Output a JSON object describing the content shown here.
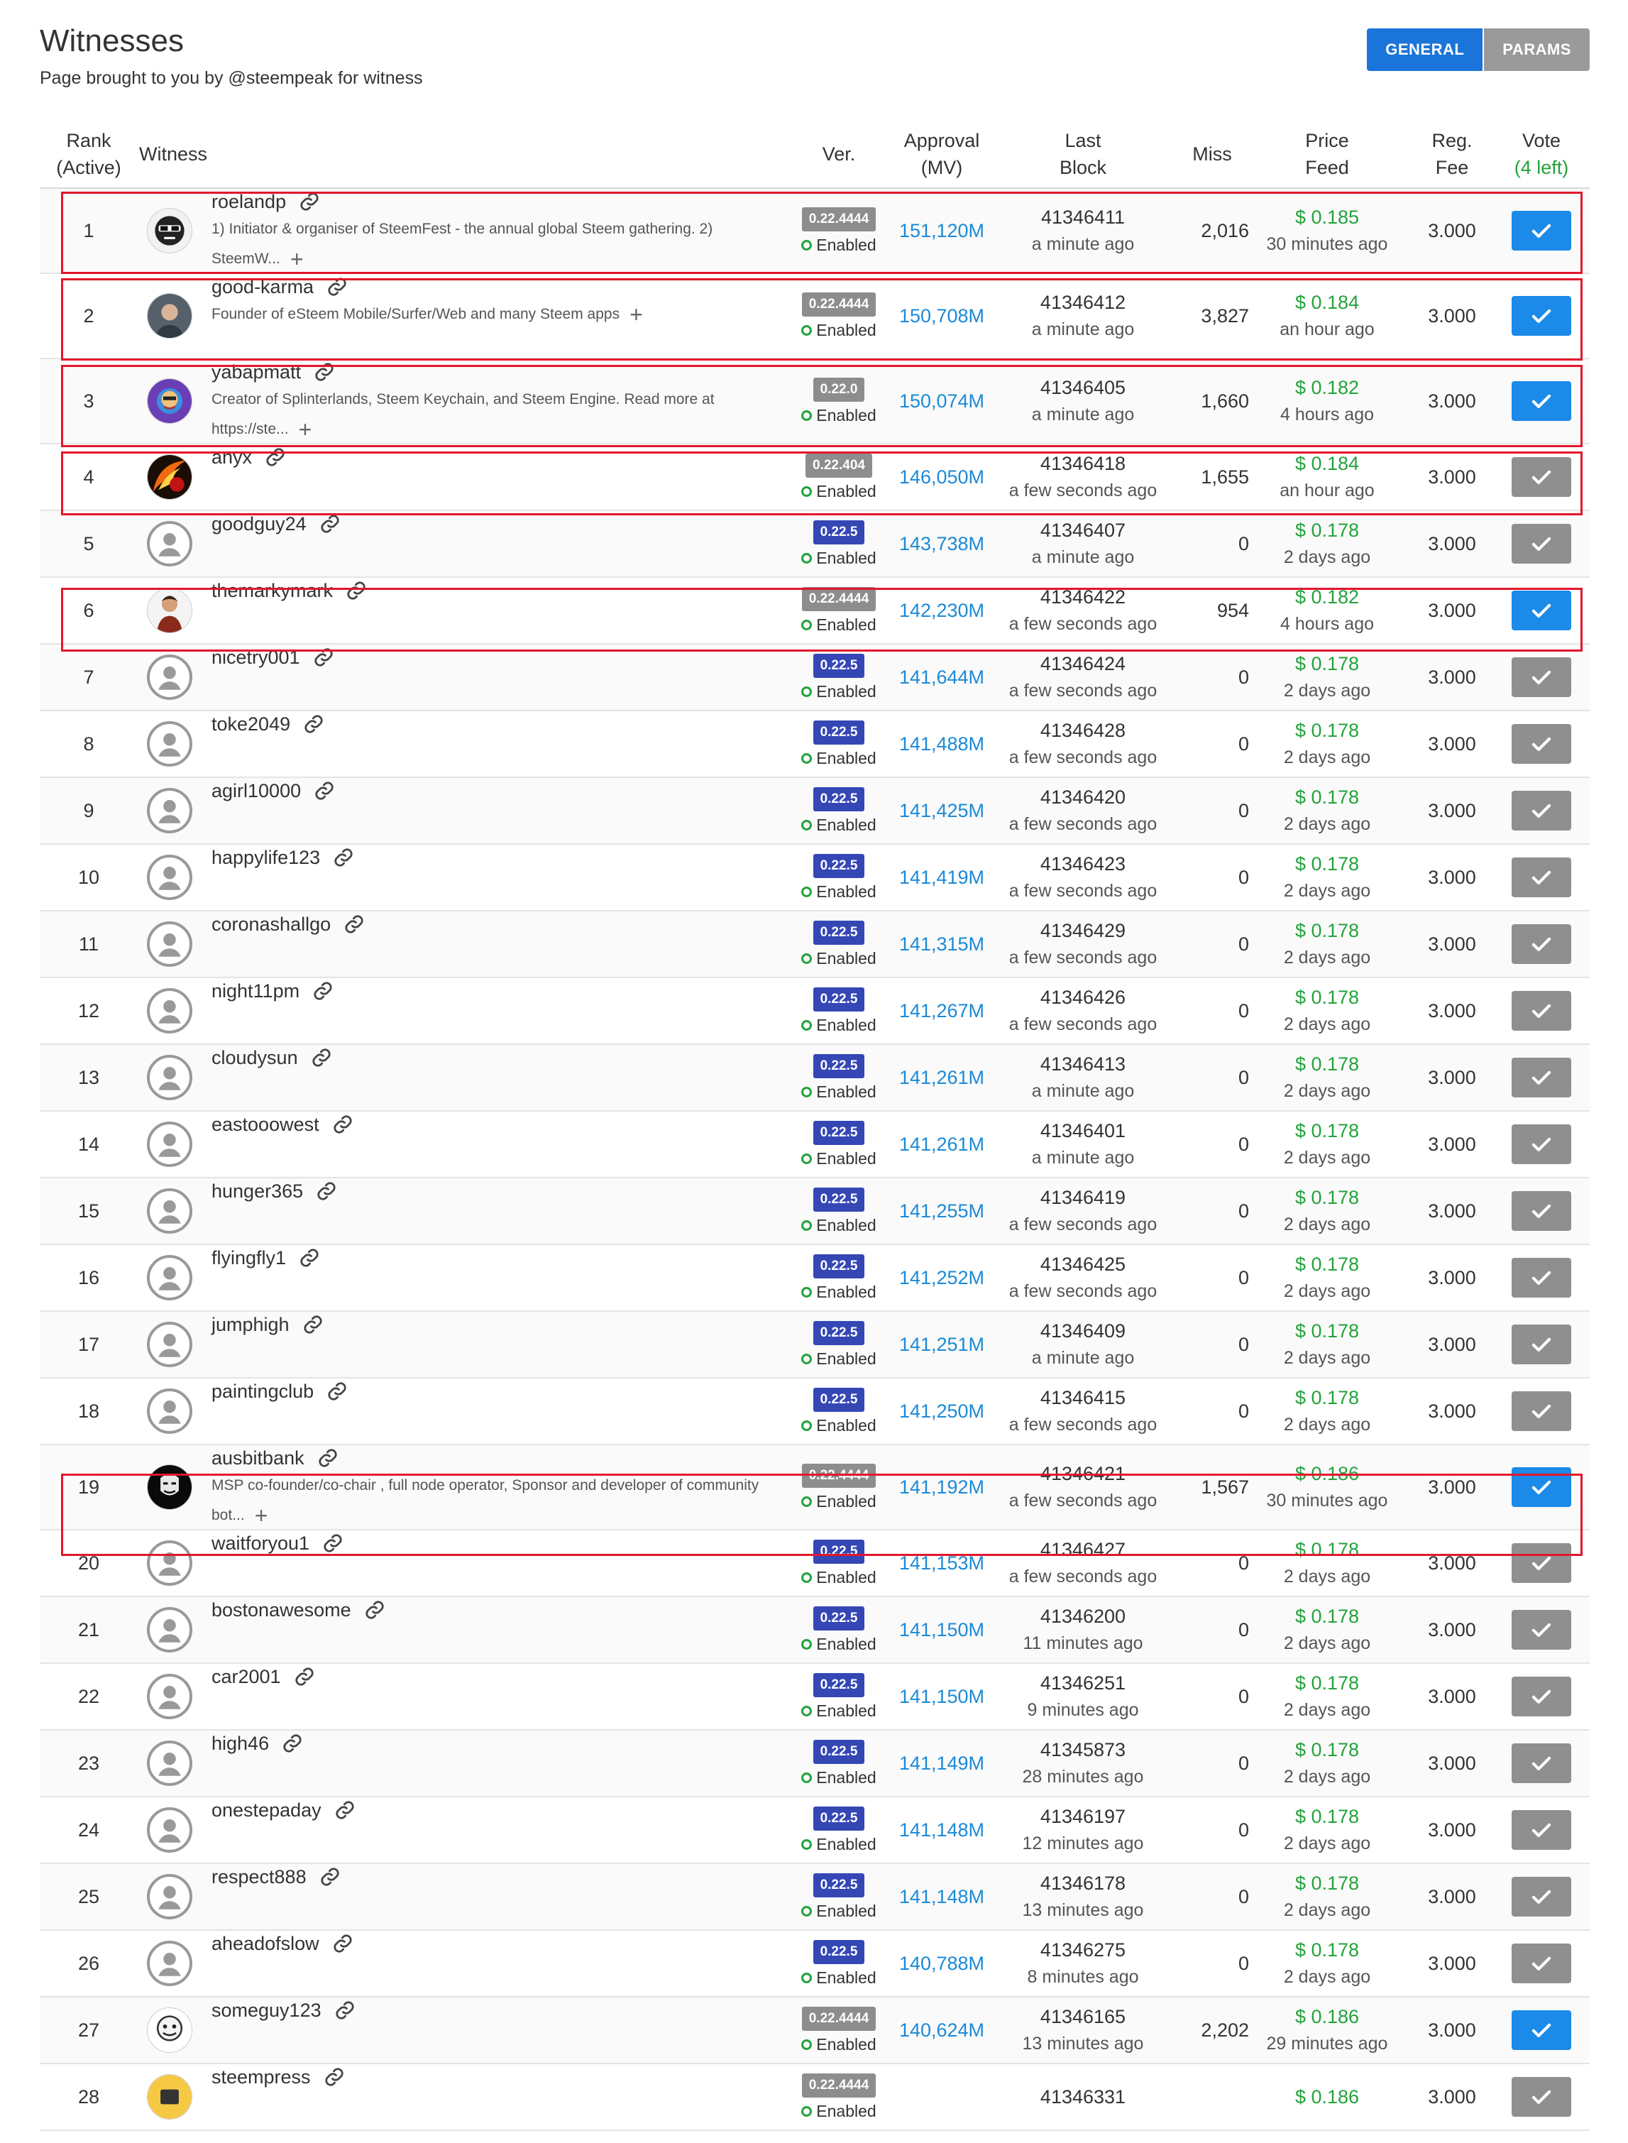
{
  "header": {
    "title": "Witnesses",
    "subtitle": "Page brought to you by @steempeak for witness",
    "tabs": [
      "GENERAL",
      "PARAMS"
    ]
  },
  "columns": {
    "rank": "Rank",
    "rank_sub": "(Active)",
    "witness": "Witness",
    "ver": "Ver.",
    "approval": "Approval",
    "approval_sub": "(MV)",
    "last": "Last",
    "last_sub": "Block",
    "miss": "Miss",
    "price": "Price",
    "price_sub": "Feed",
    "fee": "Reg.",
    "fee_sub": "Fee",
    "vote": "Vote",
    "vote_sub": "(4 left)"
  },
  "colors": {
    "accent": "#1b74d9",
    "vote_on": "#1b8ae8",
    "vote_off": "#8f8f8f",
    "price": "#23a33b",
    "highlight": "#e2172d",
    "badge_new": "#3447b5",
    "badge_old": "#8d8d8d"
  },
  "rows": [
    {
      "rank": "1",
      "name": "roelandp",
      "desc": "1) Initiator & organiser of SteemFest - the annual global Steem gathering. 2) SteemW...",
      "avatar": "photo-roelandp",
      "ver": "0.22.4444",
      "ver_kind": "old",
      "status": "Enabled",
      "approval": "151,120M",
      "block": "41346411",
      "block_ago": "a minute ago",
      "miss": "2,016",
      "price": "$ 0.185",
      "price_ago": "30 minutes ago",
      "fee": "3.000",
      "voted": true,
      "highlight": true
    },
    {
      "rank": "2",
      "name": "good-karma",
      "desc": "Founder of eSteem Mobile/Surfer/Web and many Steem apps",
      "avatar": "photo-good-karma",
      "ver": "0.22.4444",
      "ver_kind": "old",
      "status": "Enabled",
      "approval": "150,708M",
      "block": "41346412",
      "block_ago": "a minute ago",
      "miss": "3,827",
      "price": "$ 0.184",
      "price_ago": "an hour ago",
      "fee": "3.000",
      "voted": true,
      "highlight": true
    },
    {
      "rank": "3",
      "name": "yabapmatt",
      "desc": "Creator of Splinterlands, Steem Keychain, and Steem Engine. Read more at https://ste...",
      "avatar": "photo-yabapmatt",
      "ver": "0.22.0",
      "ver_kind": "old",
      "status": "Enabled",
      "approval": "150,074M",
      "block": "41346405",
      "block_ago": "a minute ago",
      "miss": "1,660",
      "price": "$ 0.182",
      "price_ago": "4 hours ago",
      "fee": "3.000",
      "voted": true,
      "highlight": true
    },
    {
      "rank": "4",
      "name": "anyx",
      "desc": "",
      "avatar": "photo-anyx",
      "ver": "0.22.404",
      "ver_kind": "old",
      "status": "Enabled",
      "approval": "146,050M",
      "block": "41346418",
      "block_ago": "a few seconds ago",
      "miss": "1,655",
      "price": "$ 0.184",
      "price_ago": "an hour ago",
      "fee": "3.000",
      "voted": false,
      "highlight": true
    },
    {
      "rank": "5",
      "name": "goodguy24",
      "desc": "",
      "avatar": "default",
      "ver": "0.22.5",
      "ver_kind": "new",
      "status": "Enabled",
      "approval": "143,738M",
      "block": "41346407",
      "block_ago": "a minute ago",
      "miss": "0",
      "price": "$ 0.178",
      "price_ago": "2 days ago",
      "fee": "3.000",
      "voted": false,
      "highlight": false
    },
    {
      "rank": "6",
      "name": "themarkymark",
      "desc": "",
      "avatar": "photo-themarkymark",
      "ver": "0.22.4444",
      "ver_kind": "old",
      "status": "Enabled",
      "approval": "142,230M",
      "block": "41346422",
      "block_ago": "a few seconds ago",
      "miss": "954",
      "price": "$ 0.182",
      "price_ago": "4 hours ago",
      "fee": "3.000",
      "voted": true,
      "highlight": true
    },
    {
      "rank": "7",
      "name": "nicetry001",
      "desc": "",
      "avatar": "default",
      "ver": "0.22.5",
      "ver_kind": "new",
      "status": "Enabled",
      "approval": "141,644M",
      "block": "41346424",
      "block_ago": "a few seconds ago",
      "miss": "0",
      "price": "$ 0.178",
      "price_ago": "2 days ago",
      "fee": "3.000",
      "voted": false,
      "highlight": false
    },
    {
      "rank": "8",
      "name": "toke2049",
      "desc": "",
      "avatar": "default",
      "ver": "0.22.5",
      "ver_kind": "new",
      "status": "Enabled",
      "approval": "141,488M",
      "block": "41346428",
      "block_ago": "a few seconds ago",
      "miss": "0",
      "price": "$ 0.178",
      "price_ago": "2 days ago",
      "fee": "3.000",
      "voted": false,
      "highlight": false
    },
    {
      "rank": "9",
      "name": "agirl10000",
      "desc": "",
      "avatar": "default",
      "ver": "0.22.5",
      "ver_kind": "new",
      "status": "Enabled",
      "approval": "141,425M",
      "block": "41346420",
      "block_ago": "a few seconds ago",
      "miss": "0",
      "price": "$ 0.178",
      "price_ago": "2 days ago",
      "fee": "3.000",
      "voted": false,
      "highlight": false
    },
    {
      "rank": "10",
      "name": "happylife123",
      "desc": "",
      "avatar": "default",
      "ver": "0.22.5",
      "ver_kind": "new",
      "status": "Enabled",
      "approval": "141,419M",
      "block": "41346423",
      "block_ago": "a few seconds ago",
      "miss": "0",
      "price": "$ 0.178",
      "price_ago": "2 days ago",
      "fee": "3.000",
      "voted": false,
      "highlight": false
    },
    {
      "rank": "11",
      "name": "coronashallgo",
      "desc": "",
      "avatar": "default",
      "ver": "0.22.5",
      "ver_kind": "new",
      "status": "Enabled",
      "approval": "141,315M",
      "block": "41346429",
      "block_ago": "a few seconds ago",
      "miss": "0",
      "price": "$ 0.178",
      "price_ago": "2 days ago",
      "fee": "3.000",
      "voted": false,
      "highlight": false
    },
    {
      "rank": "12",
      "name": "night11pm",
      "desc": "",
      "avatar": "default",
      "ver": "0.22.5",
      "ver_kind": "new",
      "status": "Enabled",
      "approval": "141,267M",
      "block": "41346426",
      "block_ago": "a few seconds ago",
      "miss": "0",
      "price": "$ 0.178",
      "price_ago": "2 days ago",
      "fee": "3.000",
      "voted": false,
      "highlight": false
    },
    {
      "rank": "13",
      "name": "cloudysun",
      "desc": "",
      "avatar": "default",
      "ver": "0.22.5",
      "ver_kind": "new",
      "status": "Enabled",
      "approval": "141,261M",
      "block": "41346413",
      "block_ago": "a minute ago",
      "miss": "0",
      "price": "$ 0.178",
      "price_ago": "2 days ago",
      "fee": "3.000",
      "voted": false,
      "highlight": false
    },
    {
      "rank": "14",
      "name": "eastooowest",
      "desc": "",
      "avatar": "default",
      "ver": "0.22.5",
      "ver_kind": "new",
      "status": "Enabled",
      "approval": "141,261M",
      "block": "41346401",
      "block_ago": "a minute ago",
      "miss": "0",
      "price": "$ 0.178",
      "price_ago": "2 days ago",
      "fee": "3.000",
      "voted": false,
      "highlight": false
    },
    {
      "rank": "15",
      "name": "hunger365",
      "desc": "",
      "avatar": "default",
      "ver": "0.22.5",
      "ver_kind": "new",
      "status": "Enabled",
      "approval": "141,255M",
      "block": "41346419",
      "block_ago": "a few seconds ago",
      "miss": "0",
      "price": "$ 0.178",
      "price_ago": "2 days ago",
      "fee": "3.000",
      "voted": false,
      "highlight": false
    },
    {
      "rank": "16",
      "name": "flyingfly1",
      "desc": "",
      "avatar": "default",
      "ver": "0.22.5",
      "ver_kind": "new",
      "status": "Enabled",
      "approval": "141,252M",
      "block": "41346425",
      "block_ago": "a few seconds ago",
      "miss": "0",
      "price": "$ 0.178",
      "price_ago": "2 days ago",
      "fee": "3.000",
      "voted": false,
      "highlight": false
    },
    {
      "rank": "17",
      "name": "jumphigh",
      "desc": "",
      "avatar": "default",
      "ver": "0.22.5",
      "ver_kind": "new",
      "status": "Enabled",
      "approval": "141,251M",
      "block": "41346409",
      "block_ago": "a minute ago",
      "miss": "0",
      "price": "$ 0.178",
      "price_ago": "2 days ago",
      "fee": "3.000",
      "voted": false,
      "highlight": false
    },
    {
      "rank": "18",
      "name": "paintingclub",
      "desc": "",
      "avatar": "default",
      "ver": "0.22.5",
      "ver_kind": "new",
      "status": "Enabled",
      "approval": "141,250M",
      "block": "41346415",
      "block_ago": "a few seconds ago",
      "miss": "0",
      "price": "$ 0.178",
      "price_ago": "2 days ago",
      "fee": "3.000",
      "voted": false,
      "highlight": false
    },
    {
      "rank": "19",
      "name": "ausbitbank",
      "desc": "MSP co-founder/co-chair , full node operator, Sponsor and developer of community bot...",
      "avatar": "photo-ausbitbank",
      "ver": "0.22.4444",
      "ver_kind": "old",
      "status": "Enabled",
      "approval": "141,192M",
      "block": "41346421",
      "block_ago": "a few seconds ago",
      "miss": "1,567",
      "price": "$ 0.186",
      "price_ago": "30 minutes ago",
      "fee": "3.000",
      "voted": true,
      "highlight": true
    },
    {
      "rank": "20",
      "name": "waitforyou1",
      "desc": "",
      "avatar": "default",
      "ver": "0.22.5",
      "ver_kind": "new",
      "status": "Enabled",
      "approval": "141,153M",
      "block": "41346427",
      "block_ago": "a few seconds ago",
      "miss": "0",
      "price": "$ 0.178",
      "price_ago": "2 days ago",
      "fee": "3.000",
      "voted": false,
      "highlight": false
    },
    {
      "rank": "21",
      "name": "bostonawesome",
      "desc": "",
      "avatar": "default",
      "ver": "0.22.5",
      "ver_kind": "new",
      "status": "Enabled",
      "approval": "141,150M",
      "block": "41346200",
      "block_ago": "11 minutes ago",
      "miss": "0",
      "price": "$ 0.178",
      "price_ago": "2 days ago",
      "fee": "3.000",
      "voted": false,
      "highlight": false
    },
    {
      "rank": "22",
      "name": "car2001",
      "desc": "",
      "avatar": "default",
      "ver": "0.22.5",
      "ver_kind": "new",
      "status": "Enabled",
      "approval": "141,150M",
      "block": "41346251",
      "block_ago": "9 minutes ago",
      "miss": "0",
      "price": "$ 0.178",
      "price_ago": "2 days ago",
      "fee": "3.000",
      "voted": false,
      "highlight": false
    },
    {
      "rank": "23",
      "name": "high46",
      "desc": "",
      "avatar": "default",
      "ver": "0.22.5",
      "ver_kind": "new",
      "status": "Enabled",
      "approval": "141,149M",
      "block": "41345873",
      "block_ago": "28 minutes ago",
      "miss": "0",
      "price": "$ 0.178",
      "price_ago": "2 days ago",
      "fee": "3.000",
      "voted": false,
      "highlight": false
    },
    {
      "rank": "24",
      "name": "onestepaday",
      "desc": "",
      "avatar": "default",
      "ver": "0.22.5",
      "ver_kind": "new",
      "status": "Enabled",
      "approval": "141,148M",
      "block": "41346197",
      "block_ago": "12 minutes ago",
      "miss": "0",
      "price": "$ 0.178",
      "price_ago": "2 days ago",
      "fee": "3.000",
      "voted": false,
      "highlight": false
    },
    {
      "rank": "25",
      "name": "respect888",
      "desc": "",
      "avatar": "default",
      "ver": "0.22.5",
      "ver_kind": "new",
      "status": "Enabled",
      "approval": "141,148M",
      "block": "41346178",
      "block_ago": "13 minutes ago",
      "miss": "0",
      "price": "$ 0.178",
      "price_ago": "2 days ago",
      "fee": "3.000",
      "voted": false,
      "highlight": false
    },
    {
      "rank": "26",
      "name": "aheadofslow",
      "desc": "",
      "avatar": "default",
      "ver": "0.22.5",
      "ver_kind": "new",
      "status": "Enabled",
      "approval": "140,788M",
      "block": "41346275",
      "block_ago": "8 minutes ago",
      "miss": "0",
      "price": "$ 0.178",
      "price_ago": "2 days ago",
      "fee": "3.000",
      "voted": false,
      "highlight": false
    },
    {
      "rank": "27",
      "name": "someguy123",
      "desc": "",
      "avatar": "photo-someguy123",
      "ver": "0.22.4444",
      "ver_kind": "old",
      "status": "Enabled",
      "approval": "140,624M",
      "block": "41346165",
      "block_ago": "13 minutes ago",
      "miss": "2,202",
      "price": "$ 0.186",
      "price_ago": "29 minutes ago",
      "fee": "3.000",
      "voted": true,
      "highlight": false
    },
    {
      "rank": "28",
      "name": "steempress",
      "desc": "",
      "avatar": "photo-steempress",
      "ver": "0.22.4444",
      "ver_kind": "old",
      "status": "Enabled",
      "approval": "",
      "block": "41346331",
      "block_ago": "",
      "miss": "",
      "price": "$ 0.186",
      "price_ago": "",
      "fee": "3.000",
      "voted": false,
      "highlight": false
    }
  ]
}
